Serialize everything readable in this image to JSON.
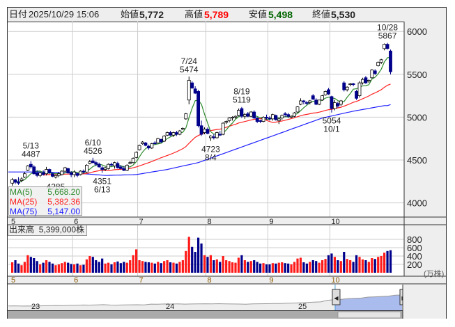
{
  "header": {
    "date_label": "日付",
    "datetime": "2025/10/29 15:06",
    "open_label": "始値",
    "open": "5,772",
    "high_label": "高値",
    "high": "5,789",
    "low_label": "安値",
    "low": "5,498",
    "close_label": "終値",
    "close": "5,530"
  },
  "legend": {
    "ma5_label": "MA(5)",
    "ma5_value": "5,668.20",
    "ma25_label": "MA(25)",
    "ma25_value": "5,382.36",
    "ma75_label": "MA(75)",
    "ma75_value": "5,147.00"
  },
  "volume": {
    "label": "出来高",
    "value": "5,399,000株",
    "unit": "(万株)"
  },
  "colors": {
    "up_candle": "#ffffff",
    "down_candle": "#00008b",
    "ma5": "#2e8b2e",
    "ma25": "#ff2020",
    "ma75": "#2020ff",
    "vol_up": "#ff1a1a",
    "vol_down": "#00008b",
    "high": "#ff0000",
    "low": "#006400"
  },
  "chart_data": {
    "type": "candlestick",
    "price_axis": {
      "ticks": [
        4000,
        4500,
        5000,
        5500,
        6000
      ],
      "labels": [
        "4000",
        "4500",
        "5000",
        "5500",
        "6000"
      ],
      "range": [
        3990,
        6120
      ]
    },
    "volume_axis": {
      "ticks": [
        200,
        400,
        600,
        800
      ],
      "labels": [
        "200",
        "400",
        "600",
        "800"
      ],
      "unit": "万株"
    },
    "months": [
      {
        "label": "5",
        "start_index": 0
      },
      {
        "label": "6",
        "start_index": 20
      },
      {
        "label": "7",
        "start_index": 41
      },
      {
        "label": "8",
        "start_index": 63
      },
      {
        "label": "9",
        "start_index": 83
      },
      {
        "label": "10",
        "start_index": 103
      }
    ],
    "ohlcv_columns": [
      "open",
      "high",
      "low",
      "close",
      "volume_man"
    ],
    "ohlcv": [
      [
        4230,
        4290,
        4200,
        4270,
        250
      ],
      [
        4270,
        4280,
        4220,
        4240,
        300
      ],
      [
        4240,
        4300,
        4210,
        4230,
        220
      ],
      [
        4260,
        4300,
        4240,
        4280,
        180
      ],
      [
        4300,
        4360,
        4290,
        4340,
        260
      ],
      [
        4380,
        4440,
        4370,
        4430,
        420
      ],
      [
        4450,
        4487,
        4400,
        4420,
        380
      ],
      [
        4420,
        4440,
        4330,
        4340,
        350
      ],
      [
        4350,
        4380,
        4300,
        4320,
        280
      ],
      [
        4320,
        4360,
        4300,
        4350,
        200
      ],
      [
        4350,
        4380,
        4320,
        4330,
        240
      ],
      [
        4340,
        4420,
        4320,
        4390,
        300
      ],
      [
        4390,
        4400,
        4340,
        4350,
        260
      ],
      [
        4340,
        4350,
        4300,
        4310,
        220
      ],
      [
        4300,
        4330,
        4285,
        4320,
        180
      ],
      [
        4320,
        4360,
        4300,
        4340,
        200
      ],
      [
        4330,
        4380,
        4320,
        4370,
        230
      ],
      [
        4370,
        4420,
        4360,
        4410,
        260
      ],
      [
        4400,
        4410,
        4340,
        4350,
        240
      ],
      [
        4350,
        4370,
        4300,
        4330,
        210
      ],
      [
        4330,
        4380,
        4300,
        4360,
        200
      ],
      [
        4340,
        4350,
        4300,
        4320,
        220
      ],
      [
        4330,
        4380,
        4320,
        4370,
        180
      ],
      [
        4370,
        4390,
        4340,
        4360,
        190
      ],
      [
        4360,
        4450,
        4350,
        4440,
        320
      ],
      [
        4460,
        4500,
        4450,
        4480,
        400
      ],
      [
        4490,
        4526,
        4460,
        4470,
        380
      ],
      [
        4470,
        4490,
        4430,
        4450,
        300
      ],
      [
        4450,
        4470,
        4410,
        4420,
        260
      ],
      [
        4410,
        4430,
        4351,
        4390,
        340
      ],
      [
        4390,
        4420,
        4370,
        4410,
        220
      ],
      [
        4400,
        4460,
        4390,
        4450,
        240
      ],
      [
        4450,
        4470,
        4430,
        4440,
        200
      ],
      [
        4430,
        4480,
        4400,
        4470,
        250
      ],
      [
        4460,
        4480,
        4400,
        4410,
        270
      ],
      [
        4420,
        4440,
        4390,
        4400,
        230
      ],
      [
        4400,
        4430,
        4370,
        4380,
        260
      ],
      [
        4380,
        4450,
        4370,
        4440,
        240
      ],
      [
        4460,
        4490,
        4450,
        4470,
        300
      ],
      [
        4470,
        4530,
        4460,
        4520,
        420
      ],
      [
        4530,
        4600,
        4520,
        4590,
        560
      ],
      [
        4620,
        4680,
        4610,
        4670,
        300
      ],
      [
        4690,
        4720,
        4680,
        4710,
        280
      ],
      [
        4700,
        4710,
        4660,
        4670,
        260
      ],
      [
        4660,
        4680,
        4620,
        4640,
        250
      ],
      [
        4640,
        4700,
        4630,
        4690,
        240
      ],
      [
        4700,
        4720,
        4680,
        4690,
        220
      ],
      [
        4700,
        4760,
        4690,
        4750,
        260
      ],
      [
        4740,
        4750,
        4700,
        4710,
        230
      ],
      [
        4720,
        4790,
        4710,
        4780,
        280
      ],
      [
        4790,
        4830,
        4780,
        4820,
        300
      ],
      [
        4820,
        4840,
        4780,
        4790,
        250
      ],
      [
        4790,
        4830,
        4770,
        4820,
        240
      ],
      [
        4820,
        4840,
        4780,
        4800,
        220
      ],
      [
        4800,
        4850,
        4790,
        4840,
        260
      ],
      [
        4860,
        4880,
        4850,
        4870,
        300
      ],
      [
        4980,
        5050,
        4970,
        5040,
        520
      ],
      [
        5200,
        5474,
        5150,
        5430,
        860
      ],
      [
        5400,
        5420,
        5330,
        5340,
        620
      ],
      [
        5330,
        5360,
        5270,
        5280,
        500
      ],
      [
        5300,
        5320,
        4880,
        4900,
        840
      ],
      [
        4900,
        4960,
        4780,
        4800,
        700
      ],
      [
        4820,
        4880,
        4800,
        4860,
        420
      ],
      [
        4860,
        4880,
        4800,
        4810,
        380
      ],
      [
        4760,
        4790,
        4723,
        4780,
        420
      ],
      [
        4770,
        4800,
        4740,
        4760,
        300
      ],
      [
        4760,
        4830,
        4750,
        4820,
        320
      ],
      [
        4800,
        4840,
        4780,
        4790,
        260
      ],
      [
        4800,
        4940,
        4790,
        4930,
        400
      ],
      [
        4940,
        4960,
        4920,
        4950,
        300
      ],
      [
        4960,
        5000,
        4940,
        4990,
        280
      ],
      [
        4990,
        5010,
        4960,
        5000,
        250
      ],
      [
        5000,
        5020,
        4980,
        5010,
        240
      ],
      [
        5020,
        5100,
        5010,
        5080,
        360
      ],
      [
        5100,
        5119,
        4990,
        5010,
        420
      ],
      [
        5010,
        5050,
        4980,
        5030,
        300
      ],
      [
        5040,
        5060,
        5000,
        5010,
        260
      ],
      [
        5010,
        5070,
        5000,
        5060,
        280
      ],
      [
        5060,
        5080,
        4980,
        4990,
        300
      ],
      [
        4990,
        5000,
        4930,
        4950,
        260
      ],
      [
        4960,
        4970,
        4930,
        4950,
        220
      ],
      [
        4950,
        5010,
        4940,
        5000,
        230
      ],
      [
        5000,
        5030,
        4970,
        4990,
        200
      ],
      [
        4990,
        5010,
        4960,
        4980,
        200
      ],
      [
        4980,
        5040,
        4960,
        5030,
        230
      ],
      [
        5020,
        5030,
        4960,
        4970,
        220
      ],
      [
        4960,
        4990,
        4920,
        4980,
        240
      ],
      [
        4990,
        5030,
        4970,
        5020,
        250
      ],
      [
        5040,
        5060,
        5000,
        5030,
        230
      ],
      [
        5030,
        5050,
        4990,
        5010,
        220
      ],
      [
        5000,
        5020,
        4990,
        5010,
        200
      ],
      [
        5010,
        5060,
        5000,
        5050,
        260
      ],
      [
        5060,
        5130,
        5050,
        5120,
        340
      ],
      [
        5150,
        5220,
        5140,
        5190,
        360
      ],
      [
        5190,
        5200,
        5150,
        5180,
        250
      ],
      [
        5170,
        5190,
        5140,
        5160,
        220
      ],
      [
        5170,
        5200,
        5150,
        5190,
        260
      ],
      [
        5250,
        5270,
        5200,
        5210,
        300
      ],
      [
        5200,
        5220,
        5140,
        5150,
        280
      ],
      [
        5150,
        5200,
        5140,
        5200,
        240
      ],
      [
        5200,
        5260,
        5190,
        5250,
        300
      ],
      [
        5260,
        5310,
        5250,
        5300,
        330
      ],
      [
        5320,
        5340,
        5260,
        5270,
        420
      ],
      [
        5240,
        5250,
        5054,
        5100,
        460
      ],
      [
        5100,
        5200,
        5080,
        5170,
        380
      ],
      [
        5160,
        5180,
        5110,
        5130,
        300
      ],
      [
        5150,
        5200,
        5130,
        5190,
        280
      ],
      [
        5400,
        5420,
        5300,
        5320,
        500
      ],
      [
        5320,
        5360,
        5300,
        5350,
        330
      ],
      [
        5380,
        5400,
        5360,
        5390,
        300
      ],
      [
        5390,
        5400,
        5360,
        5380,
        260
      ],
      [
        5300,
        5320,
        5200,
        5220,
        420
      ],
      [
        5250,
        5420,
        5230,
        5400,
        380
      ],
      [
        5400,
        5460,
        5380,
        5440,
        320
      ],
      [
        5460,
        5480,
        5390,
        5400,
        300
      ],
      [
        5420,
        5440,
        5400,
        5430,
        260
      ],
      [
        5460,
        5560,
        5450,
        5550,
        350
      ],
      [
        5540,
        5560,
        5490,
        5510,
        330
      ],
      [
        5600,
        5650,
        5590,
        5640,
        380
      ],
      [
        5640,
        5680,
        5620,
        5670,
        400
      ],
      [
        5800,
        5860,
        5780,
        5850,
        480
      ],
      [
        5850,
        5867,
        5790,
        5800,
        520
      ],
      [
        5772,
        5789,
        5498,
        5530,
        540
      ]
    ],
    "ma75_samples": {
      "every": 10,
      "values": [
        4360,
        4360,
        4350,
        4320,
        4330,
        4390,
        4470,
        4600,
        4730,
        4860,
        4990,
        5070,
        5135
      ],
      "last": 5147
    },
    "annotations": [
      {
        "index": 6,
        "date": "5/13",
        "value": "4487",
        "price": 4487,
        "place": "above"
      },
      {
        "index": 14,
        "date": "",
        "value": "4285",
        "price": 4285,
        "place": "below"
      },
      {
        "index": 26,
        "date": "6/10",
        "value": "4526",
        "price": 4526,
        "place": "above"
      },
      {
        "index": 29,
        "date": "6/13",
        "value": "4351",
        "price": 4351,
        "place": "below"
      },
      {
        "index": 57,
        "date": "7/24",
        "value": "5474",
        "price": 5474,
        "place": "above"
      },
      {
        "index": 64,
        "date": "8/4",
        "value": "4723",
        "price": 4723,
        "place": "below"
      },
      {
        "index": 74,
        "date": "8/19",
        "value": "5119",
        "price": 5119,
        "place": "above"
      },
      {
        "index": 103,
        "date": "10/1",
        "value": "5054",
        "price": 5054,
        "place": "below"
      },
      {
        "index": 121,
        "date": "10/28",
        "value": "5867",
        "price": 5867,
        "place": "above"
      }
    ]
  },
  "navigator": {
    "year_labels": [
      "23",
      "24",
      "25"
    ],
    "series": [
      3800,
      3820,
      3790,
      3810,
      3780,
      3830,
      3850,
      3880,
      3870,
      3900,
      3920,
      3950,
      3940,
      3980,
      4010,
      3960,
      3940,
      3970,
      3990,
      4000,
      3980,
      4100,
      4080,
      4120,
      4110,
      4130,
      4100,
      4120,
      4140,
      4150,
      4130,
      4160,
      4140,
      4120,
      4110,
      4090,
      4130,
      4150,
      4160,
      4180,
      4200,
      4230,
      4260,
      4300,
      4350,
      4400,
      4450,
      4700,
      4800,
      4850,
      4950,
      5000,
      5050,
      5200,
      5250,
      5300,
      5350,
      5500,
      5530
    ],
    "selection_start_fraction": 0.83
  }
}
